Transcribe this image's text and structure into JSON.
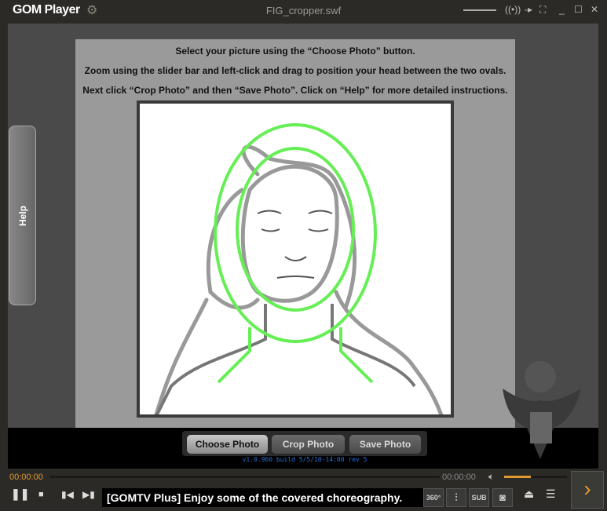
{
  "app": {
    "name": "GOM Player",
    "window_title": "FIG_cropper.swf"
  },
  "swf": {
    "instructions": [
      "Select your picture using the “Choose Photo” button.",
      "Zoom using the slider bar and left-click and drag to position your head between the two ovals.",
      "Next click “Crop Photo” and then “Save Photo”.  Click on “Help” for more detailed instructions."
    ],
    "help_label": "Help",
    "buttons": {
      "choose": "Choose Photo",
      "crop": "Crop Photo",
      "save": "Save Photo"
    },
    "version": "v1.0.960 build 5/5/10-14:00 rev 5",
    "oval_color": "#66ee55"
  },
  "player": {
    "elapsed": "00:00:00",
    "total": "00:00:00",
    "volume_percent": 43,
    "ticker": "[GOMTV Plus] Enjoy some of the covered choreography.",
    "btn_360": "360°",
    "btn_sub": "SUB",
    "accent": "#e09a30"
  }
}
